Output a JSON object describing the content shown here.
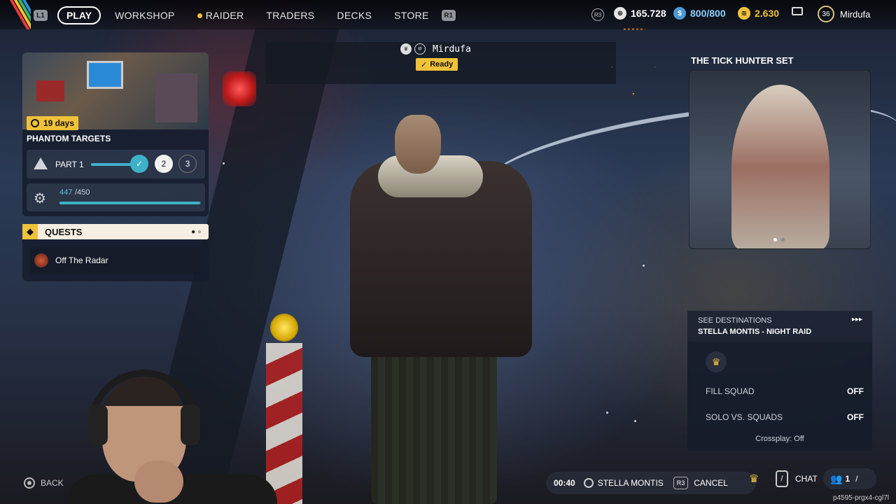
{
  "nav": {
    "l1": "L1",
    "r1": "R1",
    "items": [
      "PLAY",
      "WORKSHOP",
      "RAIDER",
      "TRADERS",
      "DECKS",
      "STORE"
    ]
  },
  "currency": {
    "r3": "R3",
    "coins": "165.728",
    "tokens": "800/800",
    "credits": "2.630",
    "level": "36",
    "username": "Mirdufa"
  },
  "event": {
    "days": "19 days",
    "title": "PHANTOM TARGETS",
    "part_label": "PART 1",
    "steps": [
      "2",
      "3"
    ],
    "progress_current": "447",
    "progress_total": "/450",
    "progress_fraction": 0.993
  },
  "quests": {
    "title": "QUESTS",
    "items": [
      "Off The Radar"
    ]
  },
  "player": {
    "name": "Mirdufa",
    "status": "Ready"
  },
  "promo": {
    "title": "THE TICK HUNTER SET"
  },
  "destination": {
    "see_label": "SEE DESTINATIONS",
    "name": "STELLA MONTIS - NIGHT RAID",
    "fill_squad_label": "FILL SQUAD",
    "fill_squad_value": "OFF",
    "solo_label": "SOLO VS. SQUADS",
    "solo_value": "OFF",
    "crossplay": "Crossplay: Off"
  },
  "bottom": {
    "back_label": "BACK",
    "timer": "00:40",
    "map": "STELLA MONTIS",
    "r3": "R3",
    "cancel_label": "CANCEL",
    "chat_label": "CHAT",
    "party_count": "1",
    "session_id": "p4595-prgx4-cgl7l"
  },
  "colors": {
    "accent_yellow": "#f0c23a",
    "progress_teal": "#3eb1c8",
    "panel_bg": "#141c2c"
  }
}
